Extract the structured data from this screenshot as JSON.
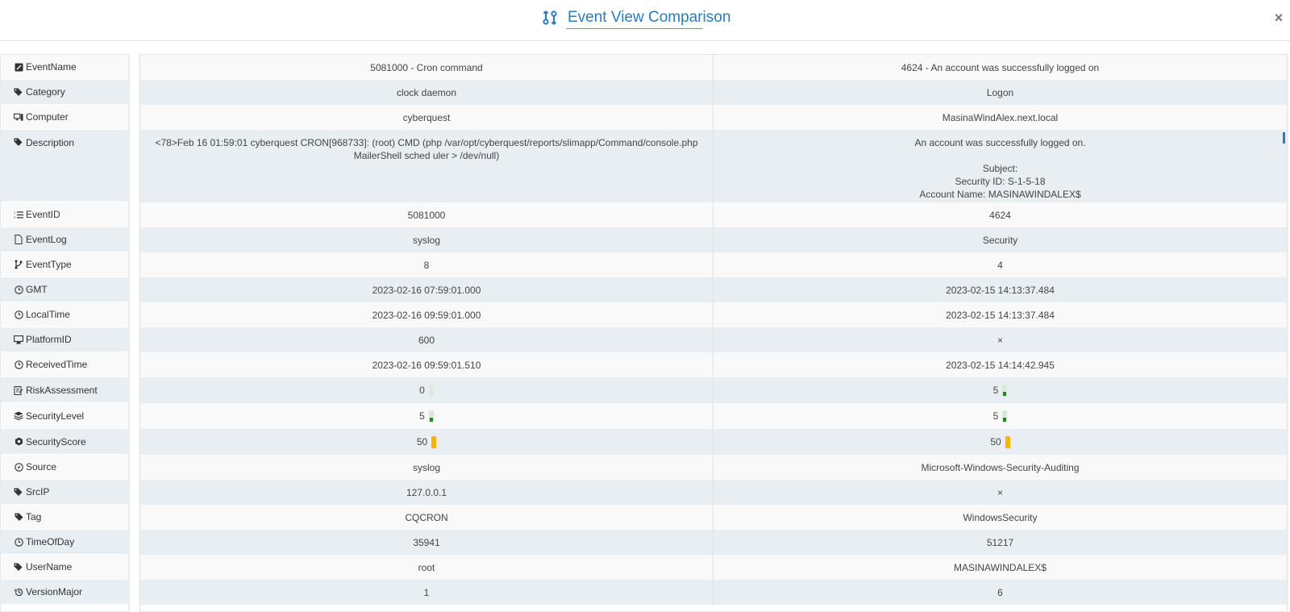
{
  "header": {
    "title": "Event View Comparison",
    "close_symbol": "×"
  },
  "labels": [
    {
      "text": "EventName",
      "icon": "edit-icon"
    },
    {
      "text": "Category",
      "icon": "tags-icon"
    },
    {
      "text": "Computer",
      "icon": "computer-icon"
    },
    {
      "text": "Description",
      "icon": "tags-icon"
    },
    {
      "text": "EventID",
      "icon": "list-ol-icon"
    },
    {
      "text": "EventLog",
      "icon": "file-icon"
    },
    {
      "text": "EventType",
      "icon": "branch-icon"
    },
    {
      "text": "GMT",
      "icon": "clock-icon"
    },
    {
      "text": "LocalTime",
      "icon": "clock-icon"
    },
    {
      "text": "PlatformID",
      "icon": "desktop-icon"
    },
    {
      "text": "ReceivedTime",
      "icon": "clock-icon"
    },
    {
      "text": "RiskAssessment",
      "icon": "clipboard-icon"
    },
    {
      "text": "SecurityLevel",
      "icon": "layers-icon"
    },
    {
      "text": "SecurityScore",
      "icon": "hexagon-icon"
    },
    {
      "text": "Source",
      "icon": "compass-icon"
    },
    {
      "text": "SrcIP",
      "icon": "tags-icon"
    },
    {
      "text": "Tag",
      "icon": "tag-icon"
    },
    {
      "text": "TimeOfDay",
      "icon": "clock-icon"
    },
    {
      "text": "UserName",
      "icon": "tags-icon"
    },
    {
      "text": "VersionMajor",
      "icon": "history-icon"
    }
  ],
  "rows": [
    {
      "left": "5081000 - Cron command",
      "right": "4624 - An account was successfully logged on"
    },
    {
      "left": "clock daemon",
      "right": "Logon"
    },
    {
      "left": "cyberquest",
      "right": "MasinaWindAlex.next.local"
    },
    {
      "left": "<78>Feb 16 01:59:01 cyberquest CRON[968733]: (root) CMD (php /var/opt/cyberquest/reports/slimapp/Command/console.php MailerShell sched uler > /dev/null)",
      "right": "An account was successfully logged on.\n\nSubject:\nSecurity ID: S-1-5-18\nAccount Name: MASINAWINDALEX$\nAccount Domain: NEXT"
    },
    {
      "left": "5081000",
      "right": "4624"
    },
    {
      "left": "syslog",
      "right": "Security"
    },
    {
      "left": "8",
      "right": "4"
    },
    {
      "left": "2023-02-16 07:59:01.000",
      "right": "2023-02-15 14:13:37.484"
    },
    {
      "left": "2023-02-16 09:59:01.000",
      "right": "2023-02-15 14:13:37.484"
    },
    {
      "left": "600",
      "right": "×"
    },
    {
      "left": "2023-02-16 09:59:01.510",
      "right": "2023-02-15 14:14:42.945"
    },
    {
      "left": "0",
      "right": "5"
    },
    {
      "left": "5",
      "right": "5"
    },
    {
      "left": "50",
      "right": "50"
    },
    {
      "left": "syslog",
      "right": "Microsoft-Windows-Security-Auditing"
    },
    {
      "left": "127.0.0.1",
      "right": "×"
    },
    {
      "left": "CQCRON",
      "right": "WindowsSecurity"
    },
    {
      "left": "35941",
      "right": "51217"
    },
    {
      "left": "root",
      "right": "MASINAWINDALEX$"
    },
    {
      "left": "1",
      "right": "6"
    }
  ],
  "bars": {
    "risk_left": "gray",
    "risk_right": "green-fill",
    "level_left": "green-fill",
    "level_right": "green-fill",
    "score_left": "orange",
    "score_right": "orange"
  },
  "colors": {
    "accent": "#2b7bbf",
    "underline": "#e06b72",
    "green": "#1d8a1d",
    "orange": "#f7b500"
  }
}
